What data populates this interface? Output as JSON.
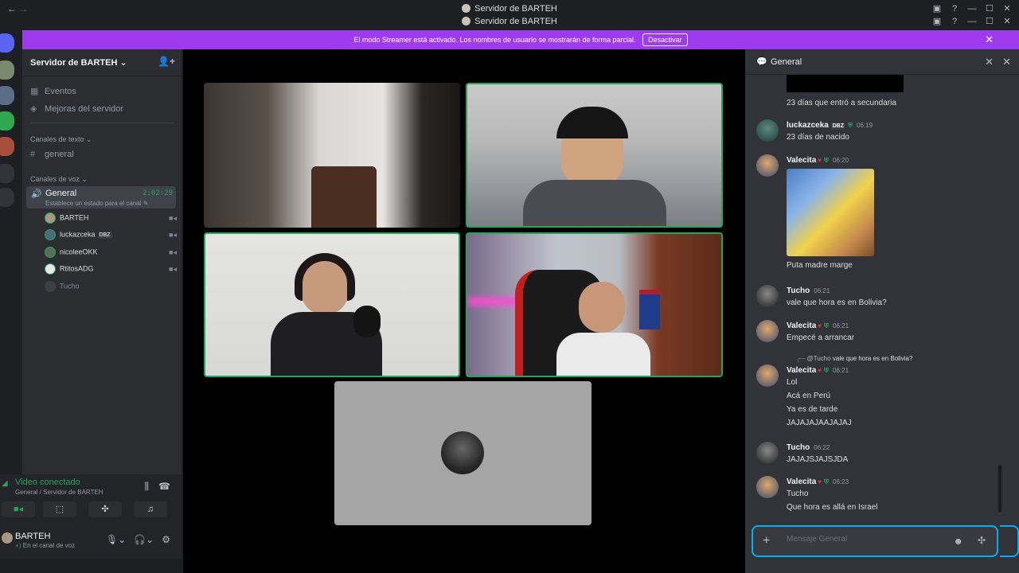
{
  "window": {
    "title": "Servidor de BARTEH",
    "title_secondary": "Servidor de BARTEH"
  },
  "banner": {
    "text": "El modo Streamer está activado. Los nombres de usuario se mostrarán de forma parcial.",
    "button": "Desactivar"
  },
  "sidebar": {
    "server_name": "Servidor de BARTEH",
    "items": [
      {
        "label": "Eventos",
        "icon": "calendar-icon"
      },
      {
        "label": "Mejoras del servidor",
        "icon": "boost-icon"
      }
    ],
    "text_category": "Canales de texto",
    "text_channel": "general",
    "voice_category": "Canales de voz",
    "voice_channel": {
      "name": "General",
      "timer": "2:02:29",
      "status_placeholder": "Establece un estado para el canal"
    },
    "voice_users": [
      {
        "name": "BARTEH",
        "color": "#a79883",
        "camera": true
      },
      {
        "name": "luckazceka",
        "color": "#4a6b7a",
        "camera": true,
        "badge": "DBZ"
      },
      {
        "name": "nicoleeOKK",
        "color": "#5b6d55",
        "camera": true
      },
      {
        "name": "RtitosADG",
        "color": "#e8e8e8",
        "camera": true
      },
      {
        "name": "Tucho",
        "color": "#3e3f44",
        "camera": false
      }
    ]
  },
  "voice_panel": {
    "status": "Video conectado",
    "location": "General / Servidor de BARTEH"
  },
  "user_panel": {
    "name": "BARTEH",
    "status": "En el canal de voz"
  },
  "chat": {
    "channel": "General",
    "messages": [
      {
        "id": "m0",
        "author": "",
        "lines": [
          "23 días que entró a secundaria"
        ]
      },
      {
        "id": "m1",
        "author": "luckazceka",
        "badge": "DBZ",
        "time": "06:19",
        "lines": [
          "23 días de nacido"
        ]
      },
      {
        "id": "m2",
        "author": "Valecita",
        "time": "06:20",
        "lines": [
          "Puta madre marge"
        ]
      },
      {
        "id": "m3",
        "author": "Tucho",
        "time": "06:21",
        "lines": [
          "vale que hora es en Bolivia?"
        ]
      },
      {
        "id": "m4",
        "author": "Valecita",
        "time": "06:21",
        "lines": [
          "Empecé a arrancar"
        ]
      },
      {
        "id": "m5",
        "author": "Valecita",
        "time": "06:21",
        "reply_to": "@Tucho",
        "reply_text": "vale que hora es en Bolivia?",
        "lines": [
          "Lol",
          "Acá en Perú",
          "Ya es de tarde",
          "JAJAJAJAAJAJAJ"
        ]
      },
      {
        "id": "m6",
        "author": "Tucho",
        "time": "06:22",
        "lines": [
          "JAJAJSJAJSJDA"
        ]
      },
      {
        "id": "m7",
        "author": "Valecita",
        "time": "06:23",
        "lines": [
          "Tucho",
          "Que hora es allá en Israel"
        ]
      }
    ],
    "composer_placeholder": "Mensaje General"
  },
  "colors": {
    "accent_green": "#23a55a",
    "streamer_purple": "#9e3bf0",
    "focus_blue": "#00b0f4"
  }
}
